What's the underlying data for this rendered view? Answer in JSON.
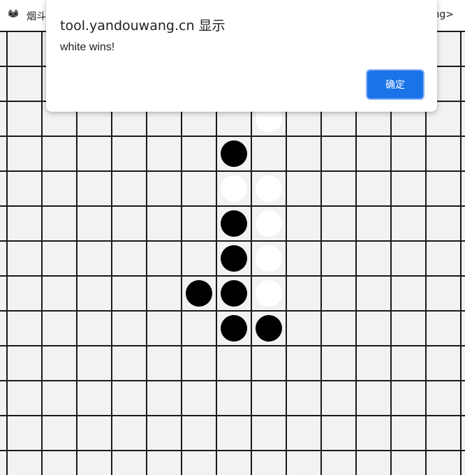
{
  "browser": {
    "site_name": "烟斗",
    "right_text": "</thinking>",
    "logo_icon": "raccoon-logo-icon"
  },
  "board": {
    "background_color": "#f2f2f2",
    "line_color": "#1a1a1a",
    "black_stones": [
      {
        "col": 6,
        "row": 4
      },
      {
        "col": 6,
        "row": 6
      },
      {
        "col": 6,
        "row": 7
      },
      {
        "col": 5,
        "row": 8
      },
      {
        "col": 6,
        "row": 8
      },
      {
        "col": 6,
        "row": 9
      },
      {
        "col": 7,
        "row": 9
      }
    ],
    "white_stones": [
      {
        "col": 7,
        "row": 3
      },
      {
        "col": 6,
        "row": 5
      },
      {
        "col": 7,
        "row": 5
      },
      {
        "col": 7,
        "row": 6
      },
      {
        "col": 7,
        "row": 7
      },
      {
        "col": 7,
        "row": 8
      }
    ]
  },
  "dialog": {
    "title": "tool.yandouwang.cn 显示",
    "message": "white wins!",
    "ok_label": "确定",
    "accent_color": "#1a73e8"
  }
}
